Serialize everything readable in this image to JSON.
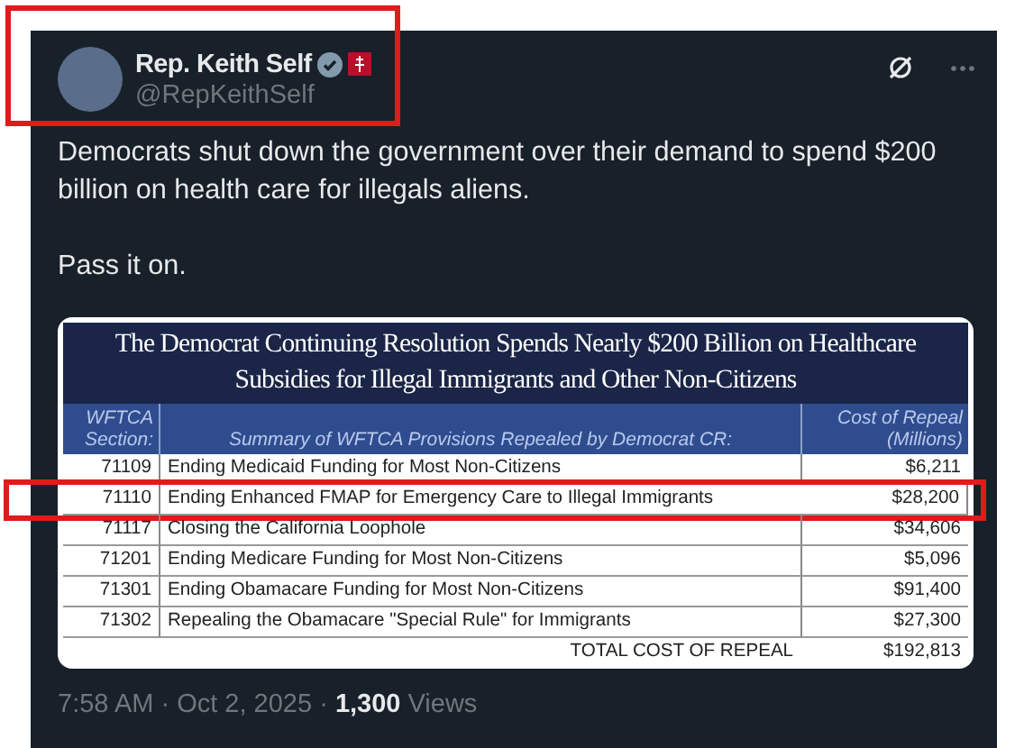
{
  "author": {
    "name": "Rep. Keith Self",
    "handle": "@RepKeithSelf",
    "verified": true,
    "highlighted": true
  },
  "text": [
    "Democrats shut down the government over their demand to spend $200 billion on health care for illegals aliens.",
    "Pass it on."
  ],
  "image_table": {
    "title": "The Democrat Continuing Resolution Spends Nearly $200 Billion on Healthcare Subsidies for Illegal Immigrants and Other Non-Citizens",
    "columns": [
      "WFTCA Section:",
      "Summary of WFTCA Provisions Repealed by Democrat CR:",
      "Cost of Repeal (Millions)"
    ],
    "rows": [
      {
        "section": "71109",
        "summary": "Ending Medicaid Funding for Most Non-Citizens",
        "cost": "$6,211",
        "highlighted": false
      },
      {
        "section": "71110",
        "summary": "Ending Enhanced FMAP for Emergency Care to Illegal Immigrants",
        "cost": "$28,200",
        "highlighted": true
      },
      {
        "section": "71117",
        "summary": "Closing the California Loophole",
        "cost": "$34,606",
        "highlighted": false
      },
      {
        "section": "71201",
        "summary": "Ending Medicare Funding for Most Non-Citizens",
        "cost": "$5,096",
        "highlighted": false
      },
      {
        "section": "71301",
        "summary": "Ending Obamacare Funding for Most Non-Citizens",
        "cost": "$91,400",
        "highlighted": false
      },
      {
        "section": "71302",
        "summary": "Repealing the Obamacare \"Special Rule\" for Immigrants",
        "cost": "$27,300",
        "highlighted": false
      }
    ],
    "total_label": "TOTAL COST OF REPEAL",
    "total": "$192,813"
  },
  "footer": "7:58 AM · Oct 2, 2025 · **1,300** Views"
}
